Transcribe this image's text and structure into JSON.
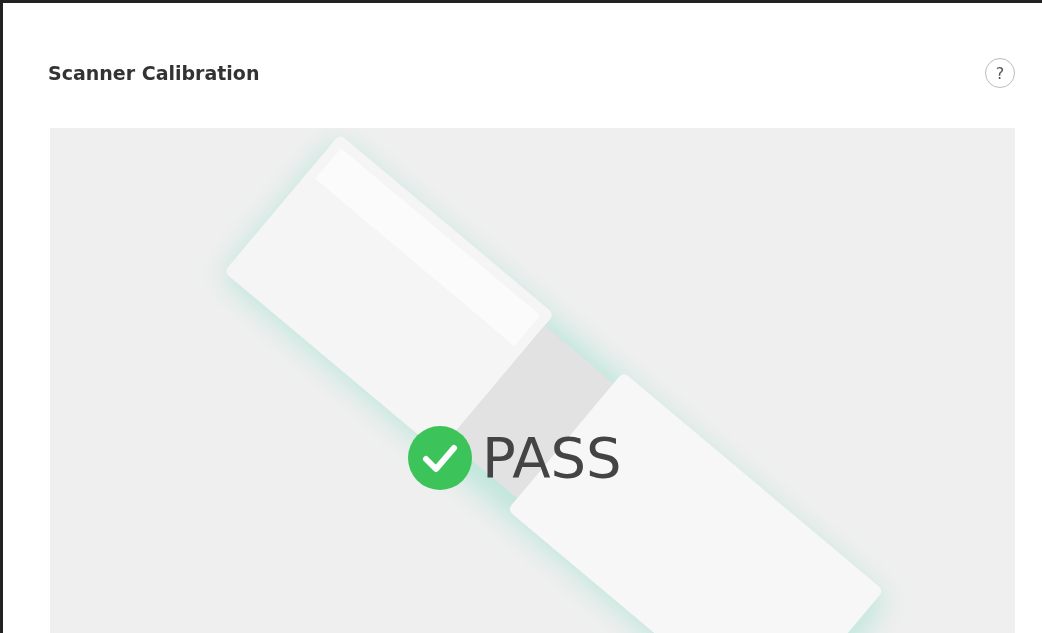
{
  "title": "Scanner Calibration",
  "help": "?",
  "result": {
    "passed": true,
    "label": "PASS"
  }
}
